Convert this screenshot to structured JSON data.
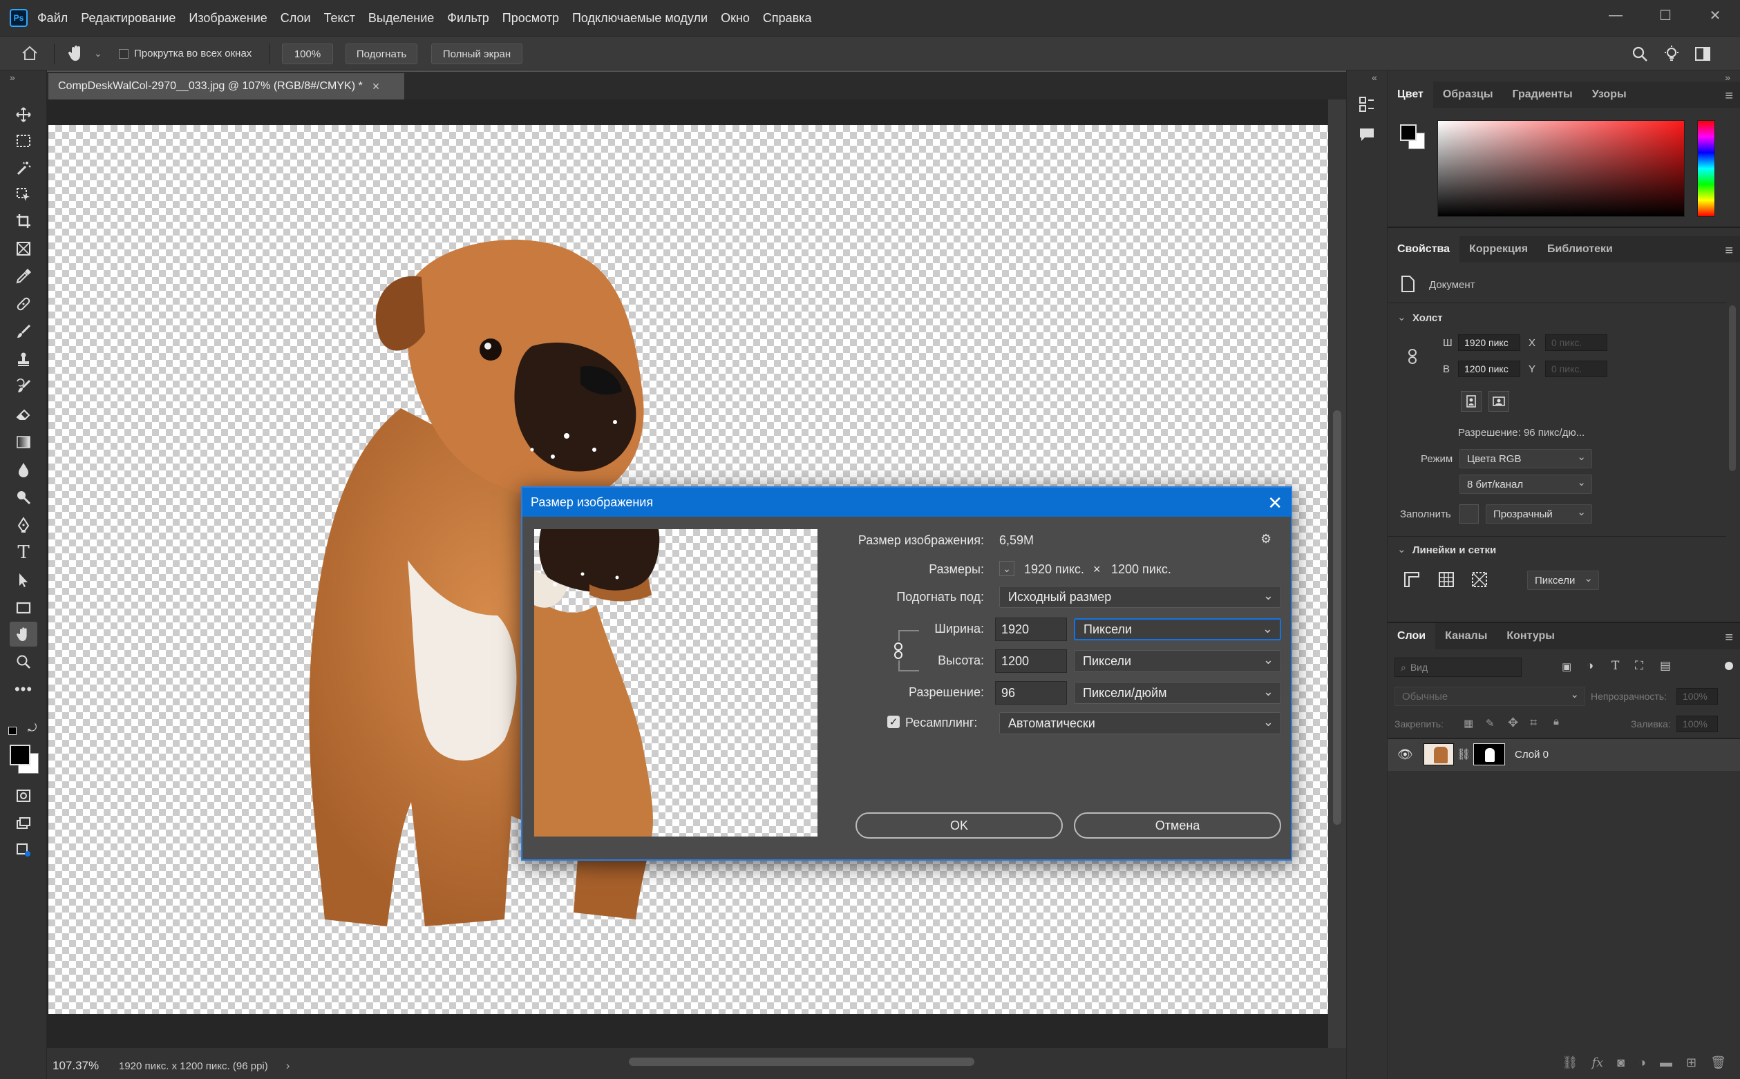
{
  "app": {
    "menu": [
      "Файл",
      "Редактирование",
      "Изображение",
      "Слои",
      "Текст",
      "Выделение",
      "Фильтр",
      "Просмотр",
      "Подключаемые модули",
      "Окно",
      "Справка"
    ],
    "logo": "Ps"
  },
  "options_bar": {
    "scroll_all_windows": "Прокрутка во всех окнах",
    "zoom_100": "100%",
    "fit": "Подогнать",
    "fullscreen": "Полный экран"
  },
  "document": {
    "tab_title": "CompDeskWalCol-2970__033.jpg @ 107% (RGB/8#/CMYK) *",
    "tab_close": "×"
  },
  "status": {
    "zoom": "107.37%",
    "size": "1920 пикс. x 1200 пикс. (96 ppi)",
    "arrow": "›"
  },
  "color_panel": {
    "tabs": [
      "Цвет",
      "Образцы",
      "Градиенты",
      "Узоры"
    ],
    "foreground": "#000000",
    "background": "#ffffff"
  },
  "properties_panel": {
    "tabs": [
      "Свойства",
      "Коррекция",
      "Библиотеки"
    ],
    "doc_label": "Документ",
    "canvas_section": "Холст",
    "w_label": "Ш",
    "w_value": "1920 пикс",
    "h_label": "В",
    "h_value": "1200 пикс",
    "x_label": "X",
    "x_value": "0 пикс.",
    "y_label": "Y",
    "y_value": "0 пикс.",
    "resolution": "Разрешение: 96 пикс/дю...",
    "mode_label": "Режим",
    "mode_value": "Цвета RGB",
    "depth_value": "8 бит/канал",
    "fill_label": "Заполнить",
    "fill_value": "Прозрачный",
    "rulers_section": "Линейки и сетки",
    "units_value": "Пиксели"
  },
  "layers_panel": {
    "tabs": [
      "Слои",
      "Каналы",
      "Контуры"
    ],
    "search_placeholder": "Вид",
    "blend_mode": "Обычные",
    "opacity_label": "Непрозрачность:",
    "opacity_value": "100%",
    "lock_label": "Закрепить:",
    "fill_label": "Заливка:",
    "fill_value": "100%",
    "layers": [
      {
        "name": "Слой 0"
      }
    ]
  },
  "dialog": {
    "title": "Размер изображения",
    "close": "✕",
    "image_size_label": "Размер изображения:",
    "image_size_value": "6,59M",
    "dimensions_label": "Размеры:",
    "dim_w": "1920 пикс.",
    "dim_x": "×",
    "dim_h": "1200 пикс.",
    "fit_label": "Подогнать под:",
    "fit_value": "Исходный размер",
    "width_label": "Ширина:",
    "width_value": "1920",
    "width_unit": "Пиксели",
    "height_label": "Высота:",
    "height_value": "1200",
    "height_unit": "Пиксели",
    "resolution_label": "Разрешение:",
    "resolution_value": "96",
    "resolution_unit": "Пиксели/дюйм",
    "resample_label": "Ресамплинг:",
    "resample_value": "Автоматически",
    "ok": "OK",
    "cancel": "Отмена"
  }
}
